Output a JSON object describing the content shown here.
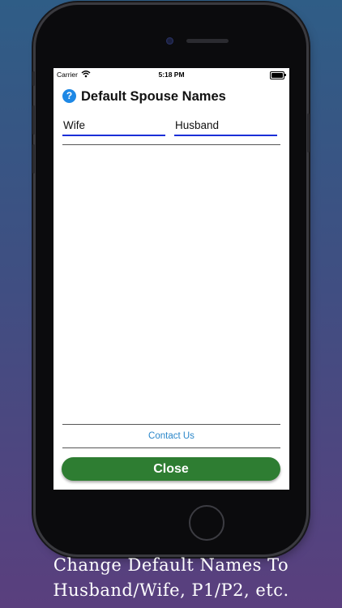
{
  "status_bar": {
    "carrier": "Carrier",
    "time": "5:18 PM"
  },
  "dialog": {
    "title": "Default Spouse Names",
    "help_icon": "?",
    "wife_field": {
      "value": "Wife"
    },
    "husband_field": {
      "value": "Husband"
    },
    "contact_link": "Contact Us",
    "close_label": "Close"
  },
  "caption": {
    "line1": "Change Default Names To",
    "line2": "Husband/Wife, P1/P2, etc."
  },
  "colors": {
    "accent_blue": "#1b2fd8",
    "help_icon_blue": "#1e88e5",
    "link_blue": "#2a86c9",
    "close_green": "#2e7d32"
  },
  "icons": [
    "question-circle-icon",
    "wifi-icon",
    "battery-icon"
  ]
}
